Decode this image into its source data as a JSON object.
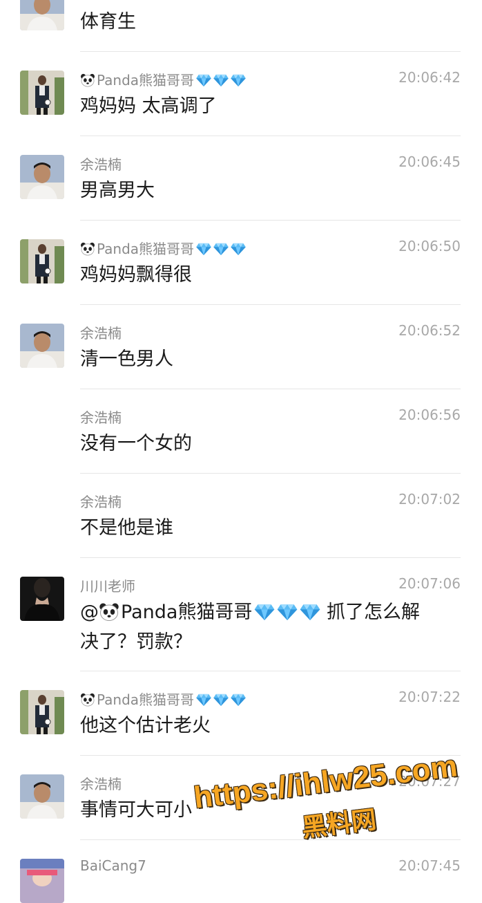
{
  "users": {
    "panda": "Panda熊猫哥哥",
    "yu": "余浩楠",
    "chuan": "川川老师",
    "bai": "BaiCang7"
  },
  "messages": [
    {
      "id": "m0",
      "sender": "",
      "time": "",
      "text": "体育生"
    },
    {
      "id": "m1",
      "sender": "Panda熊猫哥哥",
      "time": "20:06:42",
      "text": "鸡妈妈 太高调了"
    },
    {
      "id": "m2",
      "sender": "余浩楠",
      "time": "20:06:45",
      "text": "男高男大"
    },
    {
      "id": "m3",
      "sender": "Panda熊猫哥哥",
      "time": "20:06:50",
      "text": "鸡妈妈飘得很"
    },
    {
      "id": "m4",
      "sender": "余浩楠",
      "time": "20:06:52",
      "text": "清一色男人"
    },
    {
      "id": "m5",
      "sender": "余浩楠",
      "time": "20:06:56",
      "text": "没有一个女的"
    },
    {
      "id": "m6",
      "sender": "余浩楠",
      "time": "20:07:02",
      "text": "不是他是谁"
    },
    {
      "id": "m7",
      "sender": "川川老师",
      "time": "20:07:06",
      "text_mention": "@",
      "text_mention_name": "Panda熊猫哥哥",
      "text_rest": " 抓了怎么解",
      "text_line2": "决了？罚款？"
    },
    {
      "id": "m8",
      "sender": "Panda熊猫哥哥",
      "time": "20:07:22",
      "text": "他这个估计老火"
    },
    {
      "id": "m9",
      "sender": "余浩楠",
      "time": "20:07:27",
      "text": "事情可大可小"
    },
    {
      "id": "m10",
      "sender": "BaiCang7",
      "time": "20:07:45",
      "text": ""
    }
  ],
  "watermark": {
    "url": "https://ihlw25.com",
    "label": "黑料网"
  },
  "icons": {
    "panda": "panda-emoji-icon",
    "gem": "gem-stone-emoji-icon",
    "colors": {
      "gem": "#4fb3f0",
      "watermark": "#f6a623"
    }
  }
}
